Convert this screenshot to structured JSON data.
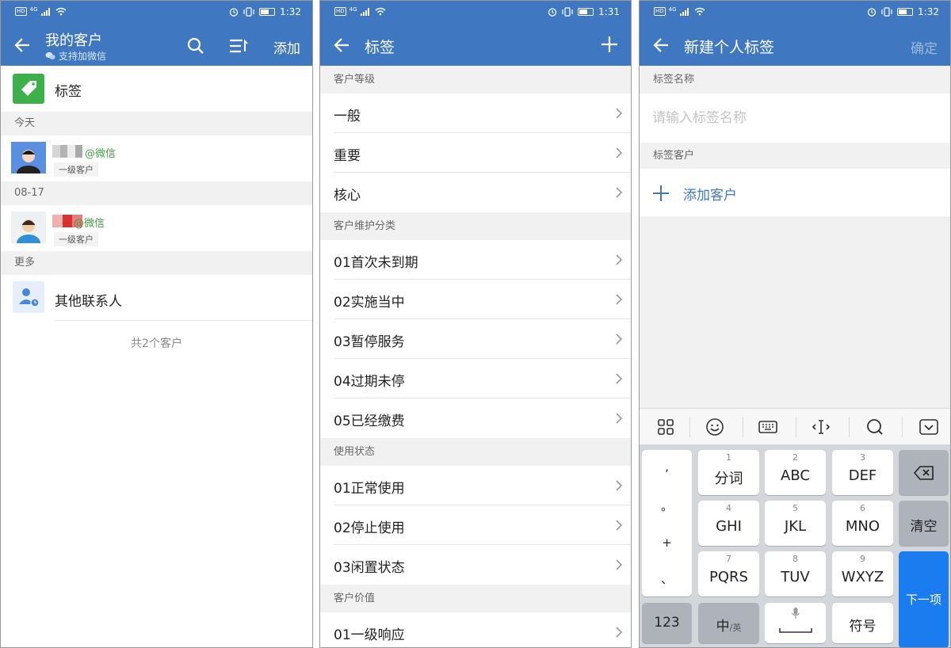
{
  "statusbar": {
    "signal": "4G",
    "time_1": "1:32",
    "time_2": "1:31",
    "time_3": "1:32"
  },
  "screen1": {
    "title": "我的客户",
    "subtitle": "支持加微信",
    "add_label": "添加",
    "tag_row_label": "标签",
    "sections": {
      "today": "今天",
      "date": "08-17",
      "more": "更多"
    },
    "customers": [
      {
        "source": "@微信",
        "level": "一级客户"
      },
      {
        "source": "@微信",
        "level": "一级客户"
      }
    ],
    "other_contacts_label": "其他联系人",
    "footer_note": "共2个客户"
  },
  "screen2": {
    "title": "标签",
    "groups": [
      {
        "header": "客户等级",
        "items": [
          "一般",
          "重要",
          "核心"
        ]
      },
      {
        "header": "客户维护分类",
        "items": [
          "01首次未到期",
          "02实施当中",
          "03暂停服务",
          "04过期未停",
          "05已经缴费"
        ]
      },
      {
        "header": "使用状态",
        "items": [
          "01正常使用",
          "02停止使用",
          "03闲置状态"
        ]
      },
      {
        "header": "客户价值",
        "items": [
          "01一级响应"
        ]
      }
    ]
  },
  "screen3": {
    "title": "新建个人标签",
    "confirm_label": "确定",
    "name_section": "标签名称",
    "name_placeholder": "请输入标签名称",
    "customers_section": "标签客户",
    "add_customer_label": "添加客户"
  },
  "keyboard": {
    "punct": [
      ",",
      "。",
      "+",
      "、"
    ],
    "keys": [
      {
        "num": "1",
        "label": "分词"
      },
      {
        "num": "2",
        "label": "ABC"
      },
      {
        "num": "3",
        "label": "DEF"
      },
      {
        "num": "4",
        "label": "GHI"
      },
      {
        "num": "5",
        "label": "JKL"
      },
      {
        "num": "6",
        "label": "MNO"
      },
      {
        "num": "7",
        "label": "PQRS"
      },
      {
        "num": "8",
        "label": "TUV"
      },
      {
        "num": "9",
        "label": "WXYZ"
      }
    ],
    "clear_label": "清空",
    "next_label": "下一项",
    "num_label": "123",
    "zh_label": "中",
    "en_label": "/英",
    "symbol_label": "符号"
  },
  "colors": {
    "header_blue": "#3f78c0",
    "tag_green": "#3db149",
    "keyboard_blue": "#1b7cf0"
  }
}
